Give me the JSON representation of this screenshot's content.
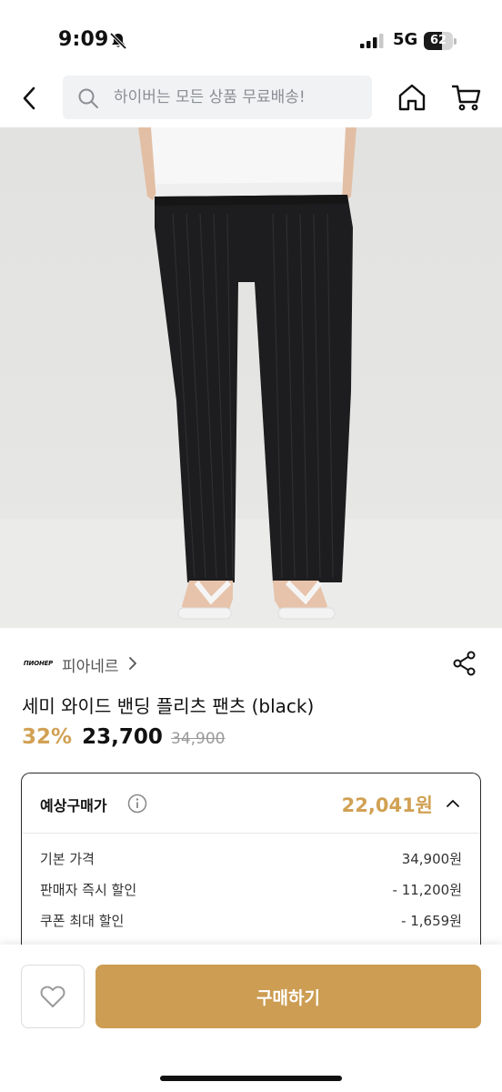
{
  "status_bar": {
    "time": "9:09",
    "network": "5G",
    "battery_level": 62,
    "battery_text": "62"
  },
  "header": {
    "search_placeholder": "하이버는 모든 상품 무료배송!",
    "icons": [
      "back-icon",
      "search-icon",
      "home-icon",
      "cart-icon"
    ]
  },
  "product": {
    "brand_logo_text": "ПИОНЕР",
    "brand_name": "피아네르",
    "title": "세미 와이드 밴딩 플리츠 팬츠 (black)",
    "discount_rate": "32%",
    "sale_price": "23,700",
    "original_price": "34,900"
  },
  "estimate": {
    "label": "예상구매가",
    "price": "22,041원",
    "rows": [
      {
        "label": "기본 가격",
        "value": "34,900원"
      },
      {
        "label": "판매자 즉시 할인",
        "value": "- 11,200원"
      },
      {
        "label": "쿠폰 최대 할인",
        "value": "- 1,659원"
      }
    ]
  },
  "bottom_bar": {
    "buy_label": "구매하기"
  },
  "colors": {
    "accent": "#cc9d52",
    "price_accent": "#d1a154",
    "search_bg": "#f1f2f4"
  }
}
